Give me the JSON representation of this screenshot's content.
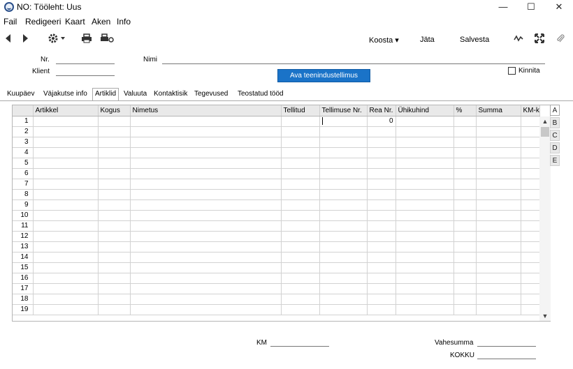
{
  "window": {
    "title": "NO: Tööleht: Uus",
    "controls": [
      "—",
      "☐",
      "✕"
    ]
  },
  "menu": [
    "Fail",
    "Redigeeri",
    "Kaart",
    "Aken",
    "Info"
  ],
  "toolbar": {
    "koosta": "Koosta ▾",
    "jata": "Jäta",
    "salvesta": "Salvesta"
  },
  "header": {
    "nr_label": "Nr.",
    "nimi_label": "Nimi",
    "klient_label": "Klient",
    "nr_value": "",
    "nimi_value": "",
    "klient_value": "",
    "ava_button": "Ava teenindustellimus",
    "kinnita_label": "Kinnita"
  },
  "tabs": [
    "Kuupäev",
    "Väjakutse info",
    "Artiklid",
    "Valuuta",
    "Kontaktisik",
    "Tegevused",
    "Teostatud tööd"
  ],
  "active_tab": "Artiklid",
  "grid": {
    "columns": [
      "",
      "Artikkel",
      "Kogus",
      "Nimetus",
      "Tellitud",
      "Tellimuse Nr.",
      "Rea Nr.",
      "Ühikuhind",
      "%",
      "Summa",
      "KM-k"
    ],
    "rows": [
      [
        "1",
        "",
        "",
        "",
        "",
        "",
        "0",
        "",
        "",
        "",
        ""
      ],
      [
        "2",
        "",
        "",
        "",
        "",
        "",
        "",
        "",
        "",
        "",
        ""
      ],
      [
        "3",
        "",
        "",
        "",
        "",
        "",
        "",
        "",
        "",
        "",
        ""
      ],
      [
        "4",
        "",
        "",
        "",
        "",
        "",
        "",
        "",
        "",
        "",
        ""
      ],
      [
        "5",
        "",
        "",
        "",
        "",
        "",
        "",
        "",
        "",
        "",
        ""
      ],
      [
        "6",
        "",
        "",
        "",
        "",
        "",
        "",
        "",
        "",
        "",
        ""
      ],
      [
        "7",
        "",
        "",
        "",
        "",
        "",
        "",
        "",
        "",
        "",
        ""
      ],
      [
        "8",
        "",
        "",
        "",
        "",
        "",
        "",
        "",
        "",
        "",
        ""
      ],
      [
        "9",
        "",
        "",
        "",
        "",
        "",
        "",
        "",
        "",
        "",
        ""
      ],
      [
        "10",
        "",
        "",
        "",
        "",
        "",
        "",
        "",
        "",
        "",
        ""
      ],
      [
        "11",
        "",
        "",
        "",
        "",
        "",
        "",
        "",
        "",
        "",
        ""
      ],
      [
        "12",
        "",
        "",
        "",
        "",
        "",
        "",
        "",
        "",
        "",
        ""
      ],
      [
        "13",
        "",
        "",
        "",
        "",
        "",
        "",
        "",
        "",
        "",
        ""
      ],
      [
        "14",
        "",
        "",
        "",
        "",
        "",
        "",
        "",
        "",
        "",
        ""
      ],
      [
        "15",
        "",
        "",
        "",
        "",
        "",
        "",
        "",
        "",
        "",
        ""
      ],
      [
        "16",
        "",
        "",
        "",
        "",
        "",
        "",
        "",
        "",
        "",
        ""
      ],
      [
        "17",
        "",
        "",
        "",
        "",
        "",
        "",
        "",
        "",
        "",
        ""
      ],
      [
        "18",
        "",
        "",
        "",
        "",
        "",
        "",
        "",
        "",
        "",
        ""
      ],
      [
        "19",
        "",
        "",
        "",
        "",
        "",
        "",
        "",
        "",
        "",
        ""
      ]
    ]
  },
  "side_tabs": [
    "A",
    "B",
    "C",
    "D",
    "E"
  ],
  "active_side_tab": "A",
  "footer": {
    "km_label": "KM",
    "vahesumma_label": "Vahesumma",
    "kokku_label": "KOKKU",
    "km_value": "",
    "vahesumma_value": "",
    "kokku_value": ""
  },
  "colors": {
    "accent_button": "#1a73c8"
  },
  "icons": [
    "back-arrow-icon",
    "forward-arrow-icon",
    "gear-icon",
    "print-icon",
    "print-preview-icon",
    "signature-icon",
    "expand-icon",
    "paperclip-icon"
  ]
}
